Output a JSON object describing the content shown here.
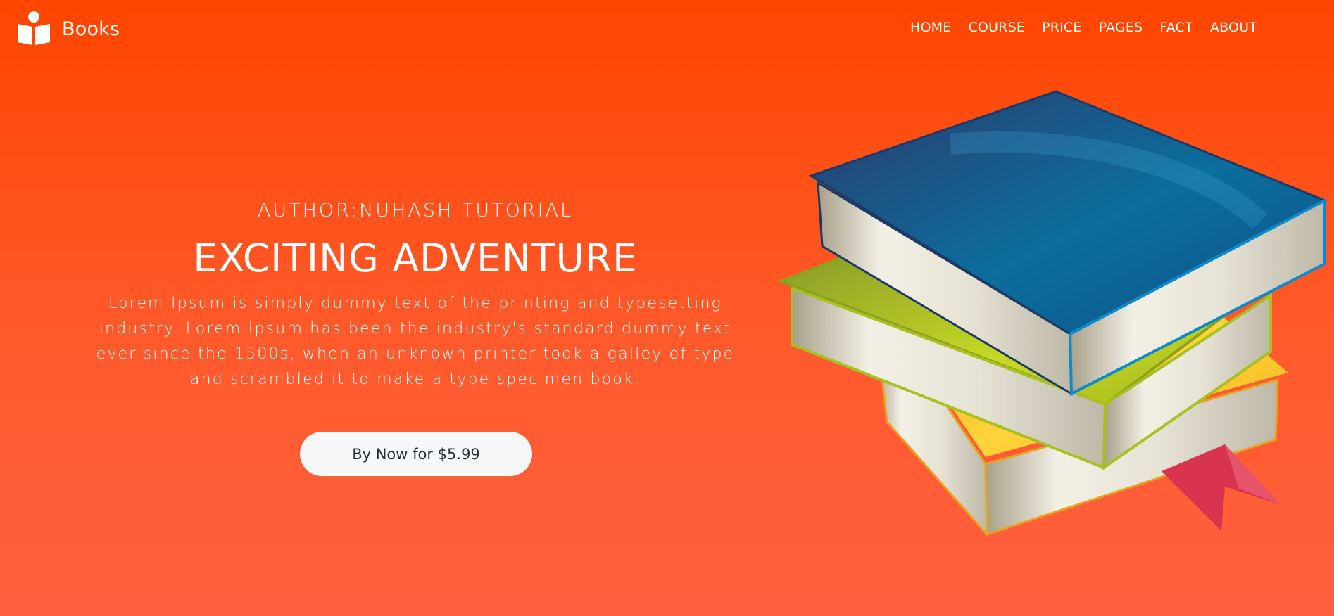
{
  "brand": {
    "name": "Books",
    "icon": "open-book-reader-icon"
  },
  "nav": {
    "items": [
      {
        "label": "HOME"
      },
      {
        "label": "COURSE"
      },
      {
        "label": "PRICE"
      },
      {
        "label": "PAGES"
      },
      {
        "label": "FACT"
      },
      {
        "label": "ABOUT"
      }
    ]
  },
  "hero": {
    "author": "AUTHOR:NUHASH TUTORIAL",
    "title": "EXCITING ADVENTURE",
    "description": "Lorem Ipsum is simply dummy text of the printing and typesetting industry. Lorem Ipsum has been the industry's standard dummy text ever since the 1500s, when an unknown printer took a galley of type and scrambled it to make a type specimen book.",
    "cta_label": "By Now for $5.99"
  },
  "colors": {
    "background_top": "#ff4500",
    "background_bottom": "#ff6040",
    "text": "#ffffff",
    "button_bg": "#f6f8fa",
    "button_text": "#2a2f3a"
  }
}
